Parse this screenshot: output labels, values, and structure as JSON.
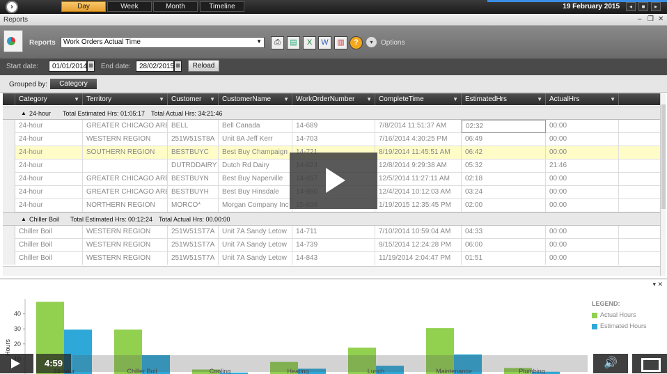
{
  "topbar": {
    "tabs": [
      "Day",
      "Week",
      "Month",
      "Timeline"
    ],
    "active_tab": "Day",
    "date": "19 February 2015"
  },
  "window": {
    "title": "Reports"
  },
  "reports": {
    "label": "Reports",
    "selected_report": "Work Orders Actual Time",
    "options_label": "Options"
  },
  "filters": {
    "start_label": "Start date:",
    "start_value": "01/01/2014",
    "end_label": "End date:",
    "end_value": "28/02/2015",
    "reload_label": "Reload"
  },
  "grouping": {
    "label": "Grouped by:",
    "value": "Category"
  },
  "grid": {
    "columns": [
      "Category",
      "Territory",
      "Customer",
      "CustomerName",
      "WorkOrderNumber",
      "CompleteTime",
      "EstimatedHrs",
      "ActualHrs"
    ],
    "groups": [
      {
        "name": "24-hour",
        "est_summary": "Total Estimated Hrs: 01:05:17",
        "act_summary": "Total Actual Hrs: 34:21:46",
        "rows": [
          [
            "24-hour",
            "GREATER CHICAGO AREA",
            "BELL",
            "Bell Canada",
            "14-689",
            "7/8/2014 11:51:37 AM",
            "02:32",
            "00:00"
          ],
          [
            "24-hour",
            "WESTERN REGION",
            "251W51ST8A",
            "Unit 8A Jeff Kerr",
            "14-703",
            "7/16/2014 4:30:25 PM",
            "06:49",
            "00:00"
          ],
          [
            "24-hour",
            "SOUTHERN REGION",
            "BESTBUYC",
            "Best Buy Champaign",
            "14-721",
            "8/19/2014 11:45:51 AM",
            "06:42",
            "00:00"
          ],
          [
            "24-hour",
            "",
            "DUTRDDAIRY",
            "Dutch Rd Dairy",
            "14-824",
            "12/8/2014 9:29:38 AM",
            "05:32",
            "21:46"
          ],
          [
            "24-hour",
            "GREATER CHICAGO AREA",
            "BESTBUYN",
            "Best Buy Naperville",
            "14-857",
            "12/5/2014 11:27:11 AM",
            "02:18",
            "00:00"
          ],
          [
            "24-hour",
            "GREATER CHICAGO AREA",
            "BESTBUYH",
            "Best Buy Hinsdale",
            "14-860",
            "12/4/2014 10:12:03 AM",
            "03:24",
            "00:00"
          ],
          [
            "24-hour",
            "NORTHERN REGION",
            "MORCO*",
            "Morgan Company Inc",
            "15-899",
            "1/19/2015 12:35:45 PM",
            "02:00",
            "00:00"
          ]
        ]
      },
      {
        "name": "Chiller Boil",
        "est_summary": "Total Estimated Hrs: 00:12:24",
        "act_summary": "Total Actual Hrs: 00.00:00",
        "rows": [
          [
            "Chiller Boil",
            "WESTERN REGION",
            "251W51ST7A",
            "Unit 7A Sandy Letow",
            "14-711",
            "7/10/2014 10:59:04 AM",
            "04:33",
            "00:00"
          ],
          [
            "Chiller Boil",
            "WESTERN REGION",
            "251W51ST7A",
            "Unit 7A Sandy Letow",
            "14-739",
            "9/15/2014 12:24:28 PM",
            "06:00",
            "00:00"
          ],
          [
            "Chiller Boil",
            "WESTERN REGION",
            "251W51ST7A",
            "Unit 7A Sandy Letow",
            "14-843",
            "11/19/2014 2:04:47 PM",
            "01:51",
            "00:00"
          ]
        ]
      }
    ]
  },
  "chart_data": {
    "type": "bar",
    "categories": [
      "24-hour",
      "Chiller Boil",
      "Cooling",
      "Heating",
      "Lunch",
      "Maintenance",
      "Plumbing"
    ],
    "series": [
      {
        "name": "Actual Hours",
        "color": "#92d050",
        "values": [
          48,
          29.5,
          3,
          8,
          17.5,
          30.5,
          4
        ]
      },
      {
        "name": "Estimated Hours",
        "color": "#2ea8d8",
        "values": [
          29.5,
          12.5,
          1,
          3.5,
          5.5,
          13,
          1.5
        ]
      }
    ],
    "ylabel": "Hours",
    "yticks": [
      10,
      20,
      30,
      40
    ],
    "ylim": [
      0,
      50
    ],
    "legend_title": "LEGEND:",
    "legend": "right"
  },
  "video": {
    "time": "4:59"
  }
}
